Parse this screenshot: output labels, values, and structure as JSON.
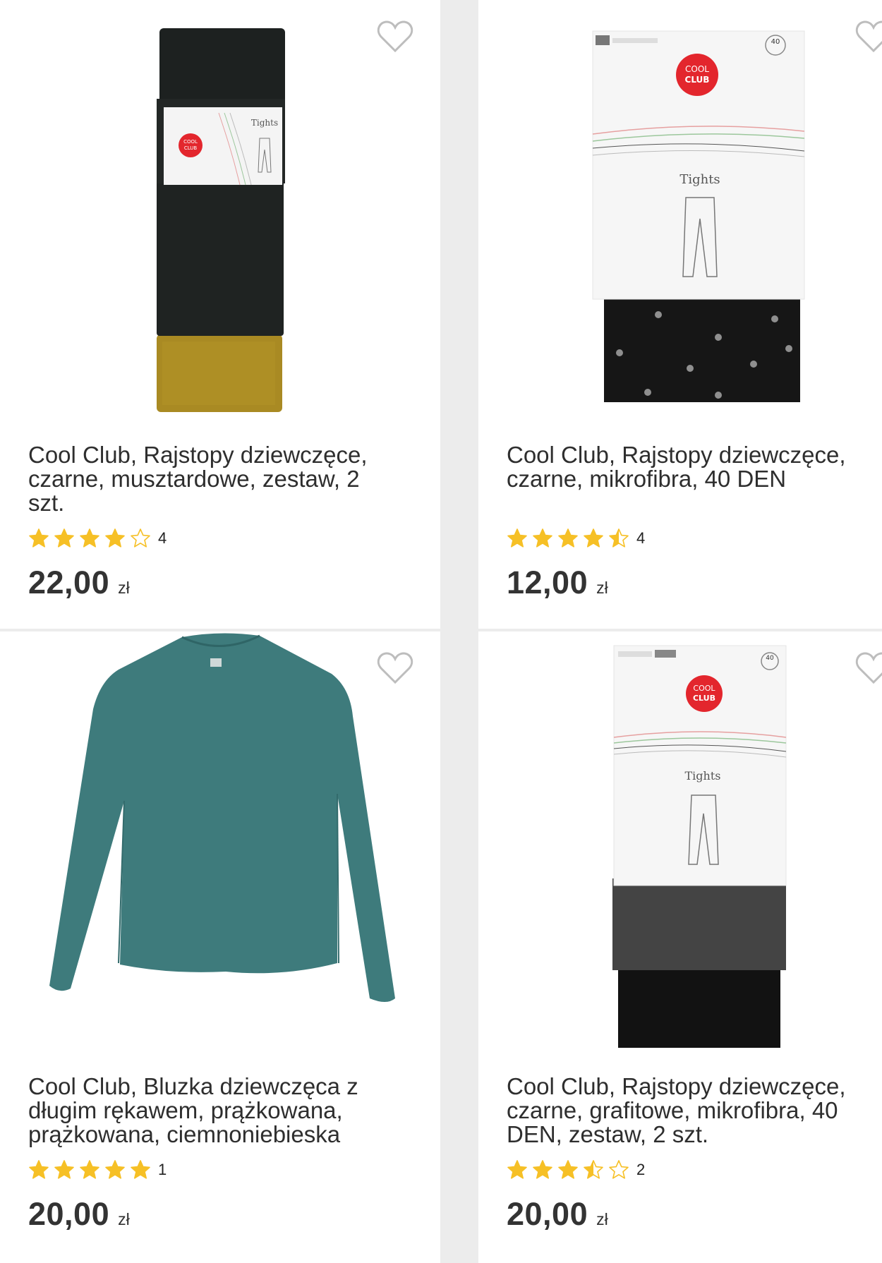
{
  "products": [
    {
      "title": "Cool Club, Rajstopy dziewczęce, czarne, musztardowe, zestaw, 2 szt.",
      "rating": 4,
      "rating_count": "4",
      "price": "22,00",
      "currency": "zł",
      "wishlist_icon": "heart-outline-icon"
    },
    {
      "title": "Cool Club, Rajstopy dziewczęce, czarne, mikrofibra, 40 DEN",
      "rating": 4.5,
      "rating_count": "4",
      "price": "12,00",
      "currency": "zł",
      "wishlist_icon": "heart-outline-icon"
    },
    {
      "title": "Cool Club, Bluzka dziewczęca z długim rękawem, prążkowana, prążkowana, ciemnoniebieska",
      "rating": 5,
      "rating_count": "1",
      "price": "20,00",
      "currency": "zł",
      "wishlist_icon": "heart-outline-icon"
    },
    {
      "title": "Cool Club, Rajstopy dziewczęce, czarne, grafitowe, mikrofibra, 40 DEN, zestaw, 2 szt.",
      "rating": 3.5,
      "rating_count": "2",
      "price": "20,00",
      "currency": "zł",
      "wishlist_icon": "heart-outline-icon"
    }
  ],
  "packaging": {
    "brand_logo": "COOL CLUB",
    "package_label": "Tights",
    "den_badge": "40"
  },
  "colors": {
    "star": "#f6c026",
    "heart_stroke": "#bdbdbd",
    "brand_red": "#e3262d"
  }
}
